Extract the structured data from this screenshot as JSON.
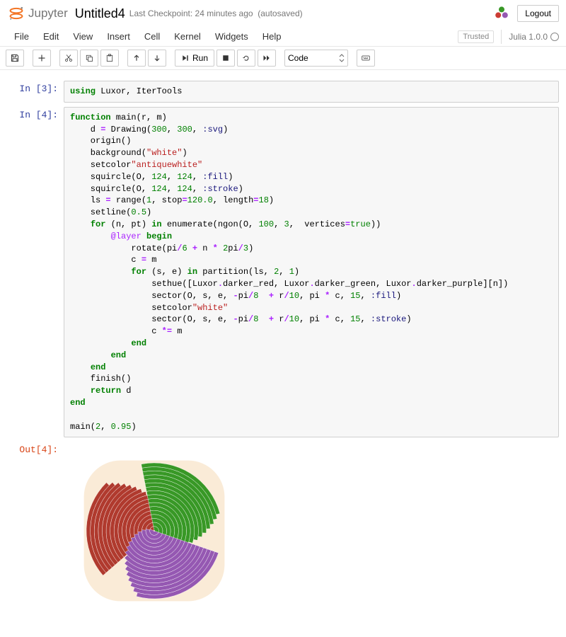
{
  "header": {
    "logo_text": "Jupyter",
    "title": "Untitled4",
    "checkpoint": "Last Checkpoint: 24 minutes ago",
    "autosaved": "(autosaved)",
    "logout": "Logout"
  },
  "menubar": {
    "items": [
      "File",
      "Edit",
      "View",
      "Insert",
      "Cell",
      "Kernel",
      "Widgets",
      "Help"
    ],
    "trusted": "Trusted",
    "kernel": "Julia 1.0.0"
  },
  "toolbar": {
    "run_label": "Run",
    "cell_type": "Code"
  },
  "cells": [
    {
      "prompt_in": "In [3]:",
      "code_html": "<span class='kw'>using</span> Luxor, IterTools"
    },
    {
      "prompt_in": "In [4]:",
      "code_html": "<span class='kw'>function</span> main(r, m)\n    d <span class='op'>=</span> Drawing(<span class='num'>300</span>, <span class='num'>300</span>, <span class='sym'>:svg</span>)\n    origin()\n    background(<span class='str'>\"white\"</span>)\n    setcolor<span class='str'>\"antiquewhite\"</span>\n    squircle(O, <span class='num'>124</span>, <span class='num'>124</span>, <span class='sym'>:fill</span>)\n    squircle(O, <span class='num'>124</span>, <span class='num'>124</span>, <span class='sym'>:stroke</span>)\n    ls <span class='op'>=</span> range(<span class='num'>1</span>, stop<span class='op'>=</span><span class='num'>120.0</span>, length<span class='op'>=</span><span class='num'>18</span>)\n    setline(<span class='num'>0.5</span>)\n    <span class='kw'>for</span> (n, pt) <span class='kw'>in</span> enumerate(ngon(O, <span class='num'>100</span>, <span class='num'>3</span>,  vertices<span class='op'>=</span><span class='num'>true</span>))\n        <span class='pa'>@layer</span> <span class='kw'>begin</span>\n            rotate(pi<span class='op'>/</span><span class='num'>6</span> <span class='op'>+</span> n <span class='op'>*</span> <span class='num'>2</span>pi<span class='op'>/</span><span class='num'>3</span>)\n            c <span class='op'>=</span> m\n            <span class='kw'>for</span> (s, e) <span class='kw'>in</span> partition(ls, <span class='num'>2</span>, <span class='num'>1</span>)\n                sethue([Luxor<span class='op'>.</span>darker_red, Luxor<span class='op'>.</span>darker_green, Luxor<span class='op'>.</span>darker_purple][n])\n                sector(O, s, e, <span class='op'>-</span>pi<span class='op'>/</span><span class='num'>8</span>  <span class='op'>+</span> r<span class='op'>/</span><span class='num'>10</span>, pi <span class='op'>*</span> c, <span class='num'>15</span>, <span class='sym'>:fill</span>)\n                setcolor<span class='str'>\"white\"</span>\n                sector(O, s, e, <span class='op'>-</span>pi<span class='op'>/</span><span class='num'>8</span>  <span class='op'>+</span> r<span class='op'>/</span><span class='num'>10</span>, pi <span class='op'>*</span> c, <span class='num'>15</span>, <span class='sym'>:stroke</span>)\n                c <span class='op'>*=</span> m\n            <span class='kw'>end</span>\n        <span class='kw'>end</span>\n    <span class='kw'>end</span>\n    finish()\n    <span class='kw'>return</span> d\n<span class='kw'>end</span>\n\nmain(<span class='num'>2</span>, <span class='num'>0.95</span>)",
      "prompt_out": "Out[4]:"
    }
  ],
  "chart_data": {
    "type": "radial-fan",
    "description": "Rounded-square antiquewhite badge with three rotated fan-shaped arc bundles",
    "background": "#faebd7",
    "sectors": 3,
    "arcs_per_sector": 17,
    "radii_range": [
      1,
      120
    ],
    "colors": [
      "#b03a2e",
      "#389826",
      "#9558b2"
    ],
    "rotation_step_deg": 120,
    "params": {
      "r": 2,
      "m": 0.95
    }
  }
}
